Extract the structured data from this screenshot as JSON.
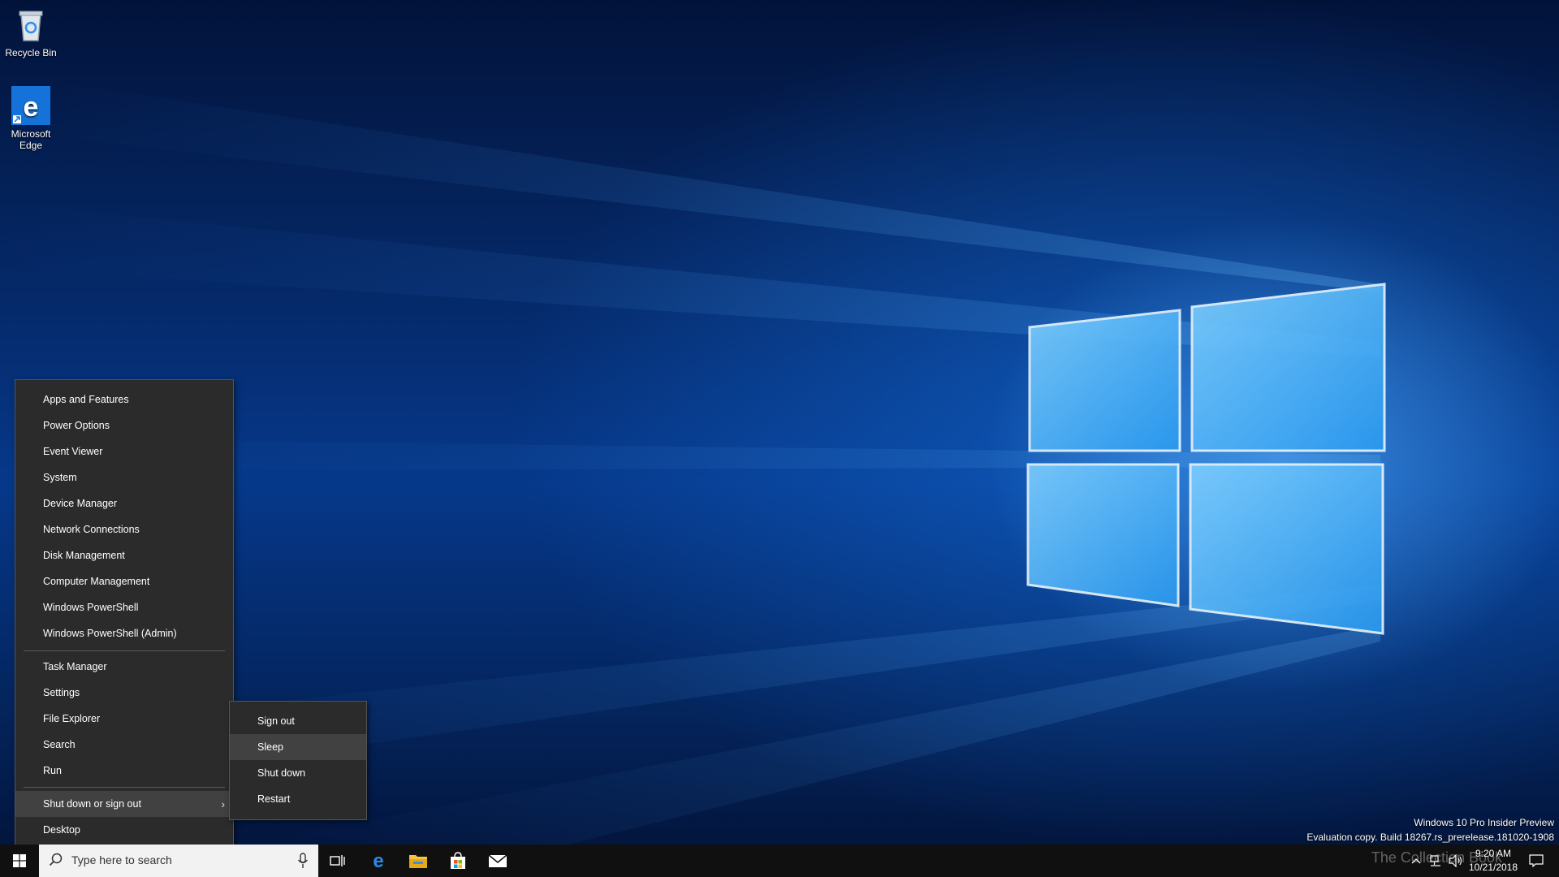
{
  "desktop": {
    "icons": [
      {
        "label": "Recycle Bin",
        "icon": "recycle-bin-icon"
      },
      {
        "label": "Microsoft Edge",
        "icon": "edge-icon"
      }
    ]
  },
  "winx_menu": {
    "items": [
      "Apps and Features",
      "Power Options",
      "Event Viewer",
      "System",
      "Device Manager",
      "Network Connections",
      "Disk Management",
      "Computer Management",
      "Windows PowerShell",
      "Windows PowerShell (Admin)",
      "Task Manager",
      "Settings",
      "File Explorer",
      "Search",
      "Run",
      "Shut down or sign out",
      "Desktop"
    ],
    "highlighted": "Shut down or sign out"
  },
  "shutdown_submenu": {
    "items": [
      "Sign out",
      "Sleep",
      "Shut down",
      "Restart"
    ],
    "highlighted": "Sleep"
  },
  "taskbar": {
    "search_placeholder": "Type here to search",
    "pinned": [
      "task-view-icon",
      "edge-icon",
      "file-explorer-icon",
      "store-icon",
      "mail-icon"
    ],
    "clock_time": "9:20 AM",
    "clock_date": "10/21/2018"
  },
  "watermark": {
    "line1": "Windows 10 Pro Insider Preview",
    "line2": "Evaluation copy. Build 18267.rs_prerelease.181020-1908"
  },
  "overlay_brand": "The Collection Book",
  "colors": {
    "menu_bg": "#2b2b2b",
    "menu_highlight": "#414141",
    "taskbar_bg": "#101010",
    "accent": "#0a74da"
  }
}
